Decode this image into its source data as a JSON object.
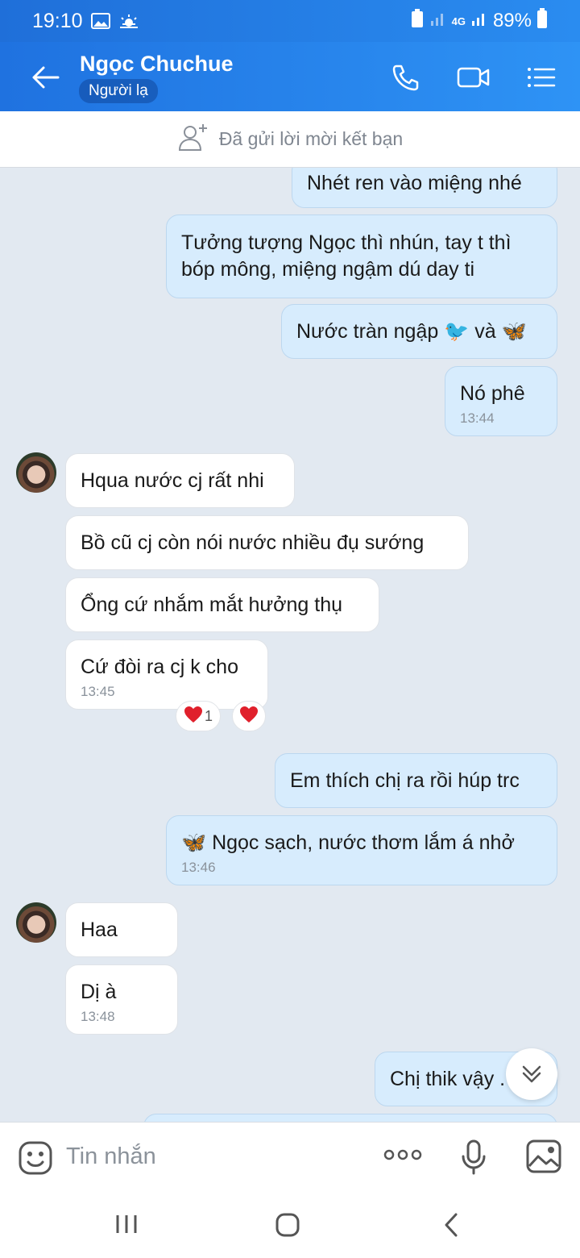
{
  "status_bar": {
    "time": "19:10",
    "network": "4G",
    "battery": "89%"
  },
  "header": {
    "title": "Ngọc Chuchue",
    "badge": "Người lạ",
    "icons": [
      "back-arrow-icon",
      "phone-icon",
      "video-call-icon",
      "menu-icon"
    ]
  },
  "friend_request": {
    "text": "Đã gửi lời mời kết bạn"
  },
  "messages": [
    {
      "side": "me",
      "text": "Nhét ren vào miệng nhé"
    },
    {
      "side": "me",
      "text": "Tưởng tượng Ngọc thì nhún, tay t thì bóp mông, miệng ngậm dú day ti"
    },
    {
      "side": "me",
      "text": "Nước tràn ngập 🐦 và 🦋"
    },
    {
      "side": "me",
      "text": "Nó phê",
      "time": "13:44"
    },
    {
      "side": "them",
      "text": "Hqua nước cj rất nhi"
    },
    {
      "side": "them",
      "text": "Bồ cũ cj còn nói nước nhiều đụ sướng"
    },
    {
      "side": "them",
      "text": "Ổng cứ nhắm mắt hưởng thụ"
    },
    {
      "side": "them",
      "text": "Cứ đòi ra cj k cho",
      "time": "13:45",
      "reaction_count": "1"
    },
    {
      "side": "me",
      "text": "Em thích chị ra rồi húp trc"
    },
    {
      "side": "me",
      "text": "🦋 Ngọc sạch, nước thơm lắm á nhở",
      "time": "13:46"
    },
    {
      "side": "them",
      "text": "Haa"
    },
    {
      "side": "them",
      "text": "Dị à",
      "time": "13:48"
    },
    {
      "side": "me",
      "text": "Chị thik vậy ."
    }
  ],
  "input": {
    "placeholder": "Tin nhắn"
  },
  "colors": {
    "header": "#2a8cf0",
    "my_bubble": "#d7ecfd",
    "their_bubble": "#ffffff",
    "background": "#e2e9f1"
  }
}
